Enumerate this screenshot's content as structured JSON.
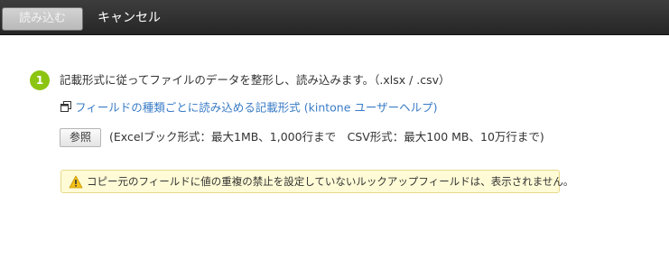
{
  "toolbar": {
    "load_label": "読み込む",
    "cancel_label": "キャンセル"
  },
  "step": {
    "number": "1",
    "text": "記載形式に従ってファイルのデータを整形し、読み込みます。（.xlsx / .csv）"
  },
  "help": {
    "icon": "external-link-icon",
    "link_text": "フィールドの種類ごとに読み込める記載形式 (kintone ユーザーヘルプ)"
  },
  "file": {
    "browse_label": "参照",
    "limits_text": "(Excelブック形式：最大1MB、1,000行まで　CSV形式：最大100 MB、10万行まで)"
  },
  "warning": {
    "icon": "warning-icon",
    "text": "コピー元のフィールドに値の重複の禁止を設定していないルックアップフィールドは、表示されません。"
  },
  "colors": {
    "toolbar_bg": "#2f2f2f",
    "step_badge": "#8cc412",
    "link": "#3a7cc6",
    "warning_bg": "#fffbd6",
    "warning_icon": "#f3c11b"
  }
}
